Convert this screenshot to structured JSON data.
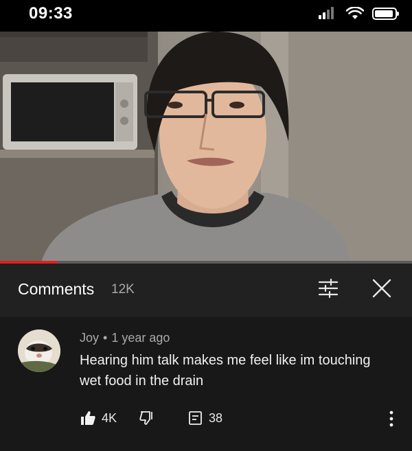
{
  "status_bar": {
    "time": "09:33",
    "icons": [
      "signal-icon",
      "wifi-icon",
      "battery-icon"
    ]
  },
  "video": {
    "progress_fraction": 0.14,
    "progress_color": "#e0201b"
  },
  "comments_header": {
    "title": "Comments",
    "count": "12K",
    "icons": [
      "filter-icon",
      "close-icon"
    ]
  },
  "comment": {
    "author": "Joy",
    "separator": "•",
    "time_ago": "1 year ago",
    "text": "Hearing him talk makes me feel like im touching wet food in the drain",
    "likes": "4K",
    "replies": "38",
    "icons": [
      "thumbs-up-icon",
      "thumbs-down-icon",
      "reply-icon",
      "more-vertical-icon"
    ]
  },
  "colors": {
    "background": "#0f0f0f",
    "header_bg": "#212121",
    "comment_bg": "#181818",
    "secondary_text": "#aaaaaa"
  }
}
